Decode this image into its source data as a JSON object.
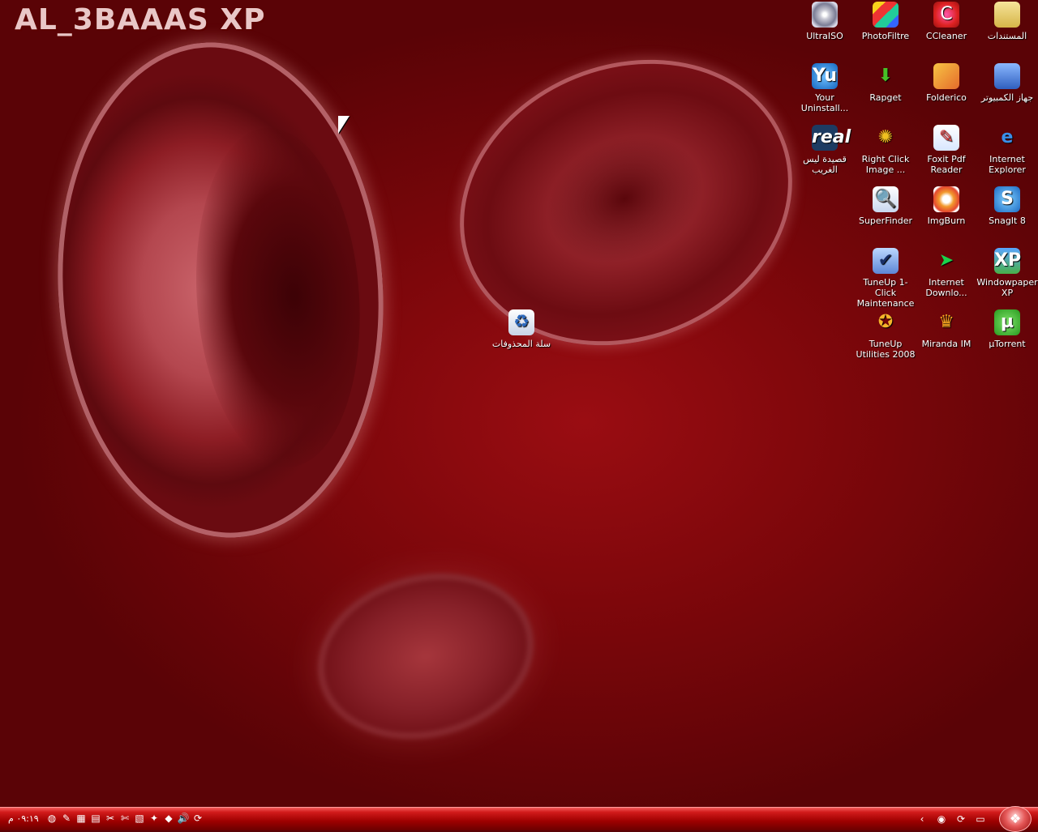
{
  "brand": {
    "text": "AL_3BAAAS XP"
  },
  "icons": [
    {
      "label": "UltraISO",
      "glyph": ""
    },
    {
      "label": "PhotoFiltre",
      "glyph": ""
    },
    {
      "label": "CCleaner",
      "glyph": "C"
    },
    {
      "label": "المستندات",
      "glyph": ""
    },
    {
      "label": "Your Uninstall...",
      "glyph": "Yu"
    },
    {
      "label": "Rapget",
      "glyph": "⬇"
    },
    {
      "label": "Folderico",
      "glyph": ""
    },
    {
      "label": "جهاز الكمبيوتر",
      "glyph": ""
    },
    {
      "label": "قصيدة ليس الغريب",
      "glyph": "real"
    },
    {
      "label": "Right Click Image ...",
      "glyph": "✺"
    },
    {
      "label": "Foxit Pdf Reader",
      "glyph": "✎"
    },
    {
      "label": "Internet Explorer",
      "glyph": "e"
    },
    {
      "label": "SuperFinder",
      "glyph": "🔍"
    },
    {
      "label": "ImgBurn",
      "glyph": ""
    },
    {
      "label": "SnagIt 8",
      "glyph": "S"
    },
    {
      "label": "TuneUp 1-Click Maintenance",
      "glyph": "✔"
    },
    {
      "label": "Internet Downlo...",
      "glyph": "➤"
    },
    {
      "label": "Windowpaper XP",
      "glyph": "XP"
    },
    {
      "label": "TuneUp Utilities 2008",
      "glyph": "✪"
    },
    {
      "label": "Miranda IM",
      "glyph": "♛"
    },
    {
      "label": "µTorrent",
      "glyph": "µ"
    },
    {
      "label": "سلة المحذوفات",
      "glyph": "♻"
    }
  ],
  "taskbar": {
    "clock": "٠٩:١٩ م",
    "quick_launch": [
      "◍",
      "✎",
      "▦",
      "▤",
      "✂",
      "✄",
      "▧",
      "✦",
      "◆",
      "🔊",
      "⟳"
    ],
    "tray": [
      "‹",
      "◉",
      "⟳",
      "▭"
    ],
    "start_glyph": "❖"
  }
}
